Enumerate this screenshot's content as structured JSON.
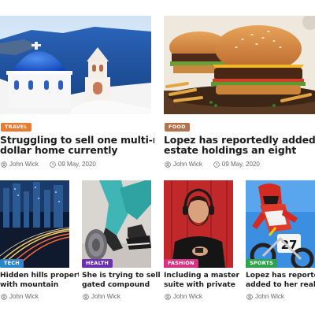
{
  "colors": {
    "travel": "#ea7a2d",
    "food": "#b3734d",
    "tech": "#2e86c9",
    "health": "#6b2fb0",
    "fashion": "#d63384",
    "sports": "#2fa34a"
  },
  "featured": [
    {
      "category": "TRAVEL",
      "title_line1": "Struggling to sell one multi-million",
      "title_line2": "dollar home currently",
      "author": "John Wick",
      "date": "09 May, 2020"
    },
    {
      "category": "FOOD",
      "title_line1": "Lopez has reportedly added to her real",
      "title_line2": "estate holdings an eight",
      "author": "John Wick",
      "date": "09 May, 2020"
    }
  ],
  "posts": [
    {
      "category": "TECH",
      "title_line1": "Hidden hills property",
      "title_line2": "with mountain",
      "author": "John Wick"
    },
    {
      "category": "HEALTH",
      "title_line1": "She is trying to sell a",
      "title_line2": "gated compound",
      "author": "John Wick"
    },
    {
      "category": "FASHION",
      "title_line1": "Including a master",
      "title_line2": "suite with private",
      "author": "John Wick"
    },
    {
      "category": "SPORTS",
      "title_line1": "Lopez has reportedly",
      "title_line2": "added to her real",
      "author": "John Wick"
    }
  ]
}
